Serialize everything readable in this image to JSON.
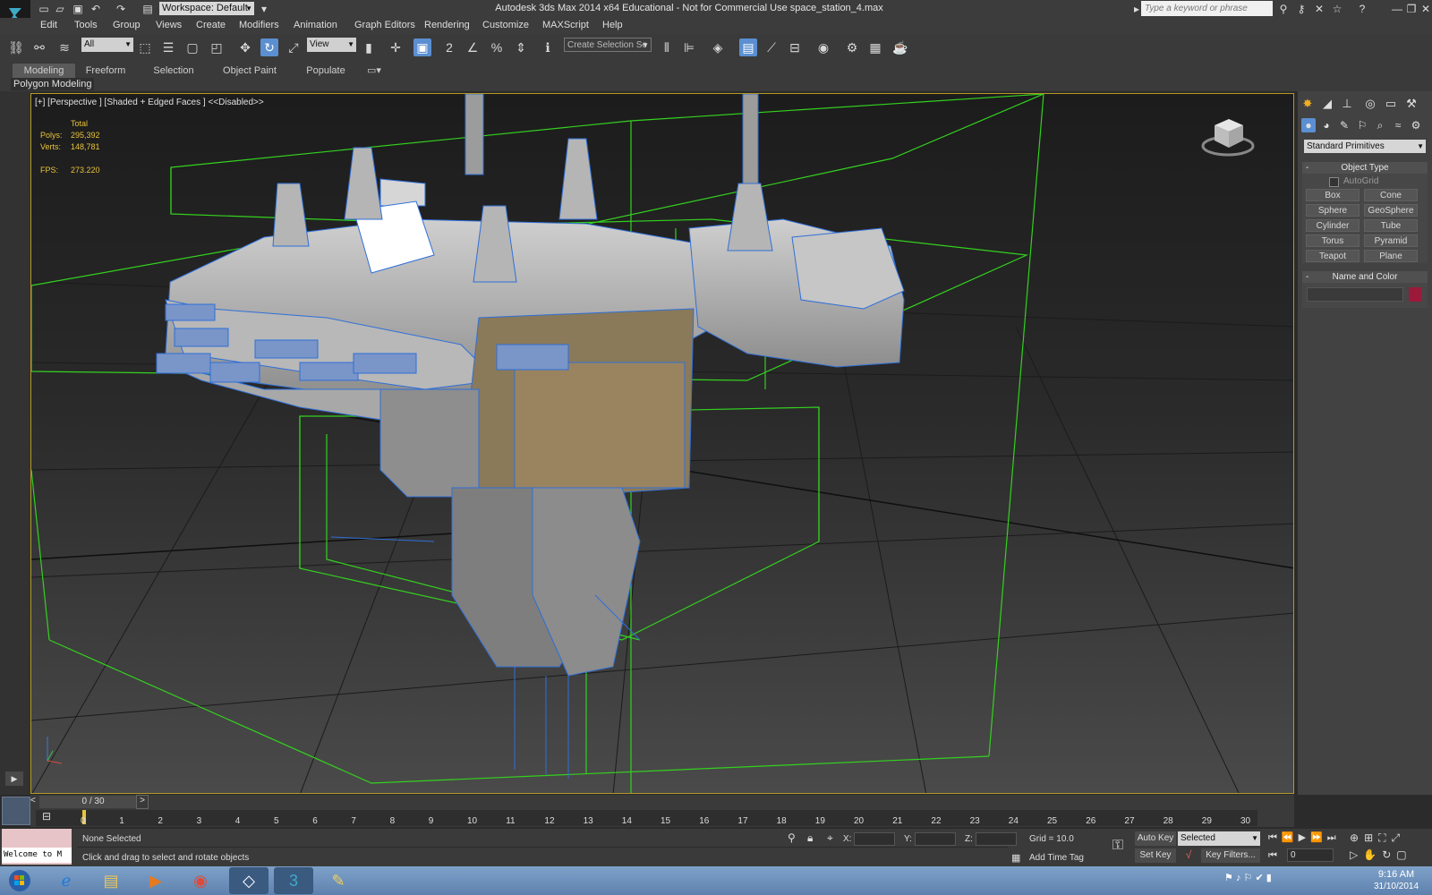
{
  "title_bar": {
    "workspace": "Workspace: Default",
    "app_title": "Autodesk 3ds Max  2014 x64   Educational - Not for Commercial Use    space_station_4.max",
    "search_placeholder": "Type a keyword or phrase"
  },
  "menu": [
    "Edit",
    "Tools",
    "Group",
    "Views",
    "Create",
    "Modifiers",
    "Animation",
    "Graph Editors",
    "Rendering",
    "Customize",
    "MAXScript",
    "Help"
  ],
  "toolbar": {
    "filter": "All",
    "ref_coord": "View",
    "selection_set": "Create Selection Se"
  },
  "ribbon": {
    "tabs": [
      "Modeling",
      "Freeform",
      "Selection",
      "Object Paint",
      "Populate"
    ],
    "active_tab": "Modeling",
    "panel_label": "Polygon Modeling"
  },
  "viewport": {
    "label": "[+] [Perspective ] [Shaded + Edged Faces ]  <<Disabled>>",
    "stats": {
      "total_label": "Total",
      "polys_label": "Polys:",
      "polys": "295,392",
      "verts_label": "Verts:",
      "verts": "148,781",
      "fps_label": "FPS:",
      "fps": "273.220"
    }
  },
  "command_panel": {
    "category": "Standard Primitives",
    "object_type_title": "Object Type",
    "autogrid": "AutoGrid",
    "primitives": [
      "Box",
      "Cone",
      "Sphere",
      "GeoSphere",
      "Cylinder",
      "Tube",
      "Torus",
      "Pyramid",
      "Teapot",
      "Plane"
    ],
    "name_color_title": "Name and Color",
    "object_color": "#9b1a3a"
  },
  "timeline": {
    "frame_display": "0 / 30",
    "ticks": [
      "0",
      "1",
      "2",
      "3",
      "4",
      "5",
      "6",
      "7",
      "8",
      "9",
      "10",
      "11",
      "12",
      "13",
      "14",
      "15",
      "16",
      "17",
      "18",
      "19",
      "20",
      "21",
      "22",
      "23",
      "24",
      "25",
      "26",
      "27",
      "28",
      "29",
      "30"
    ]
  },
  "status": {
    "welcome": "Welcome to M",
    "selection": "None Selected",
    "prompt": "Click and drag to select and rotate objects",
    "x_label": "X:",
    "y_label": "Y:",
    "z_label": "Z:",
    "grid": "Grid = 10.0",
    "add_time_tag": "Add Time Tag",
    "auto_key": "Auto Key",
    "set_key": "Set Key",
    "key_mode": "Selected",
    "key_filters": "Key Filters...",
    "frame": "0"
  },
  "taskbar": {
    "time": "9:16 AM",
    "date": "31/10/2014"
  }
}
